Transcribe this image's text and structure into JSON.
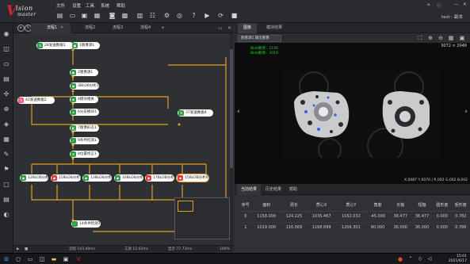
{
  "app": {
    "logo_v": "V",
    "logo_line1": "ision",
    "logo_line2": "master"
  },
  "menu": [
    "文件",
    "设置",
    "工具",
    "系统",
    "帮助"
  ],
  "toolbar_icons": [
    "new-file-icon",
    "open-folder-icon",
    "save-icon",
    "image-source-icon",
    "camera-icon",
    "grid-icon",
    "table-icon",
    "settings-icon",
    "help-icon",
    "play-icon",
    "play-loop-icon",
    "stop-icon"
  ],
  "title_right": {
    "user": "test - 副本",
    "home": "⌂",
    "info": "ⓘ"
  },
  "left_strip": [
    "image-source-icon",
    "camera-icon",
    "output-icon",
    "measure-icon",
    "position-icon",
    "crosshair-icon",
    "gauge-icon",
    "grid-icon",
    "brush-icon",
    "flag-icon",
    "lock-icon",
    "doc-icon",
    "view-icon"
  ],
  "flow_tabs": [
    "流程1",
    "流程2",
    "流程3",
    "流程4"
  ],
  "nodes": [
    {
      "label": "28发送数据1",
      "icon": "green"
    },
    {
      "label": "1图像源1",
      "icon": "green"
    },
    {
      "label": "2图像源1",
      "icon": "green"
    },
    {
      "label": "3BLOB分析1",
      "icon": "green"
    },
    {
      "label": "4模块相关",
      "icon": "green"
    },
    {
      "label": "6分支模块1",
      "icon": "green"
    },
    {
      "label": "42发送数据2",
      "icon": "pink"
    },
    {
      "label": "37发送数据4",
      "icon": "green"
    },
    {
      "label": "7图像形态1",
      "icon": "green"
    },
    {
      "label": "9条件检测1",
      "icon": "green"
    },
    {
      "label": "8位置修正1",
      "icon": "green"
    },
    {
      "label": "12BLOB分析1",
      "icon": "green"
    },
    {
      "label": "15BLOB分析2",
      "icon": "red"
    },
    {
      "label": "13BLOB分析3",
      "icon": "green"
    },
    {
      "label": "16BLOB分析4",
      "icon": "green"
    },
    {
      "label": "17BLOB分析5",
      "icon": "red"
    },
    {
      "label": "15BLOB分析6",
      "icon": "red"
    },
    {
      "label": "14条件检测1",
      "icon": "green"
    }
  ],
  "status": {
    "flow_time": "流程 143.40ms",
    "op_time": "工具 12.02ms",
    "zoom": "显示 77.73ms",
    "percent": "100%"
  },
  "image_tabs": [
    "图像",
    "模块结果"
  ],
  "image_selector": "图像源1.输出图像",
  "image_dims": "3072 × 2048",
  "overlay_lines": [
    "Blob数目：1156",
    "Blob数目：1019"
  ],
  "coords": "X,0087 Y,0070 | R,002 G,002 B,002",
  "result_tabs": [
    "当前结果",
    "历史结果",
    "帮助"
  ],
  "results": {
    "headers": [
      "序号",
      "面积",
      "周长",
      "质心X",
      "质心Y",
      "角度",
      "长轴",
      "短轴",
      "圆形度",
      "矩形度"
    ],
    "rows": [
      [
        "0",
        "1158.000",
        "124.225",
        "1035.467",
        "1162.032",
        "-45.000",
        "38.477",
        "38.477",
        "0.000",
        "0.782"
      ],
      [
        "1",
        "1019.000",
        "116.569",
        "1168.699",
        "1206.301",
        "90.000",
        "36.000",
        "36.000",
        "0.000",
        "0.786"
      ]
    ]
  },
  "taskbar_apps": [
    "windows-icon",
    "search-icon",
    "task-view-icon",
    "explorer-icon",
    "folder-icon",
    "store-icon",
    "vm-icon"
  ],
  "clock": {
    "time": "15:01",
    "date": "2021/6/17"
  }
}
